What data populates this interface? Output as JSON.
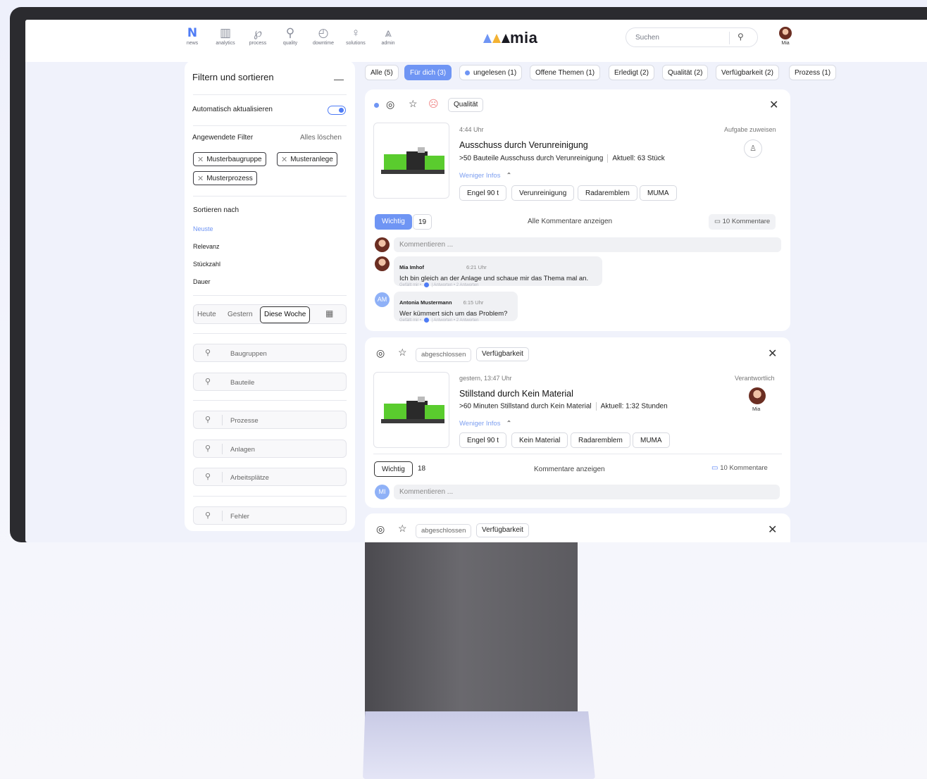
{
  "nav": [
    {
      "label": "news",
      "icon": "N",
      "active": true
    },
    {
      "label": "analytics",
      "icon": "▥"
    },
    {
      "label": "process",
      "icon": "℘"
    },
    {
      "label": "quality",
      "icon": "⚲"
    },
    {
      "label": "downtime",
      "icon": "◴"
    },
    {
      "label": "solutions",
      "icon": "♀"
    },
    {
      "label": "admin",
      "icon": "⩓"
    }
  ],
  "logo_text": "mia",
  "search": {
    "placeholder": "Suchen",
    "icon": "search-icon"
  },
  "user": {
    "name": "Mia"
  },
  "sidebar": {
    "title": "Filtern und sortieren",
    "auto_update": "Automatisch aktualisieren",
    "applied": "Angewendete Filter",
    "clear_all": "Alles löschen",
    "chips": [
      "Musterbaugruppe",
      "Musteranlege",
      "Musterprozess"
    ],
    "sort_by": "Sortieren nach",
    "sort_options": [
      "Neuste",
      "Relevanz",
      "Stückzahl",
      "Dauer"
    ],
    "dates": [
      "Heute",
      "Gestern",
      "Diese Woche"
    ],
    "fields": [
      "Baugruppen",
      "Bauteile",
      "Prozesse",
      "Anlagen",
      "Arbeitsplätze",
      "Fehler"
    ]
  },
  "tabs": [
    "Alle (5)",
    "Für dich (3)",
    "ungelesen (1)",
    "Offene Themen (1)",
    "Erledigt (2)",
    "Qualität (2)",
    "Verfügbarkeit (2)",
    "Prozess (1)"
  ],
  "cards": [
    {
      "category": "Qualität",
      "time": "4:44 Uhr",
      "title": "Ausschuss durch Verunreinigung",
      "sub1": ">50 Bauteile Ausschuss durch Verunreinigung",
      "sub2": "Aktuell: 63 Stück",
      "more": "Weniger Infos",
      "assign": "Aufgabe zuweisen",
      "tags": [
        "Engel 90 t",
        "Verunreinigung",
        "Radaremblem",
        "MUMA"
      ],
      "important": "Wichtig",
      "count": "19",
      "all_comments": "Alle Kommentare anzeigen",
      "comments_count": "10 Kommentare",
      "comment_placeholder": "Kommentieren ...",
      "comments": [
        {
          "name": "Mia Imhof",
          "time": "6:21 Uhr",
          "text": "Ich bin gleich an der Anlage und schaue mir das Thema mal an.",
          "meta_like": "Gefällt mir",
          "meta_reply": "Antworten",
          "meta_replies": "2 Antworten"
        },
        {
          "initials": "AM",
          "name": "Antonia Mustermann",
          "time": "6:15 Uhr",
          "text": "Wer kümmert sich um das Problem?",
          "meta_like": "Gefällt mir",
          "meta_reply": "Antworten",
          "meta_replies": "2 Antworten"
        }
      ]
    },
    {
      "status": "abgeschlossen",
      "category": "Verfügbarkeit",
      "time": "gestern, 13:47 Uhr",
      "title": "Stillstand durch Kein Material",
      "sub1": ">60 Minuten Stillstand durch Kein Material",
      "sub2": "Aktuell: 1:32 Stunden",
      "more": "Weniger Infos",
      "responsible": "Verantwortlich",
      "responsible_name": "Mia",
      "tags": [
        "Engel 90 t",
        "Kein Material",
        "Radaremblem",
        "MUMA"
      ],
      "important": "Wichtig",
      "count": "18",
      "all_comments": "Kommentare anzeigen",
      "comments_count": "10 Kommentare",
      "comment_placeholder": "Kommentieren ...",
      "initials": "MI"
    },
    {
      "status": "abgeschlossen",
      "category": "Verfügbarkeit"
    }
  ],
  "colors": {
    "accent": "#4f7cf5",
    "tab_active": "#6f95f4",
    "machine_green": "#55d12b"
  }
}
